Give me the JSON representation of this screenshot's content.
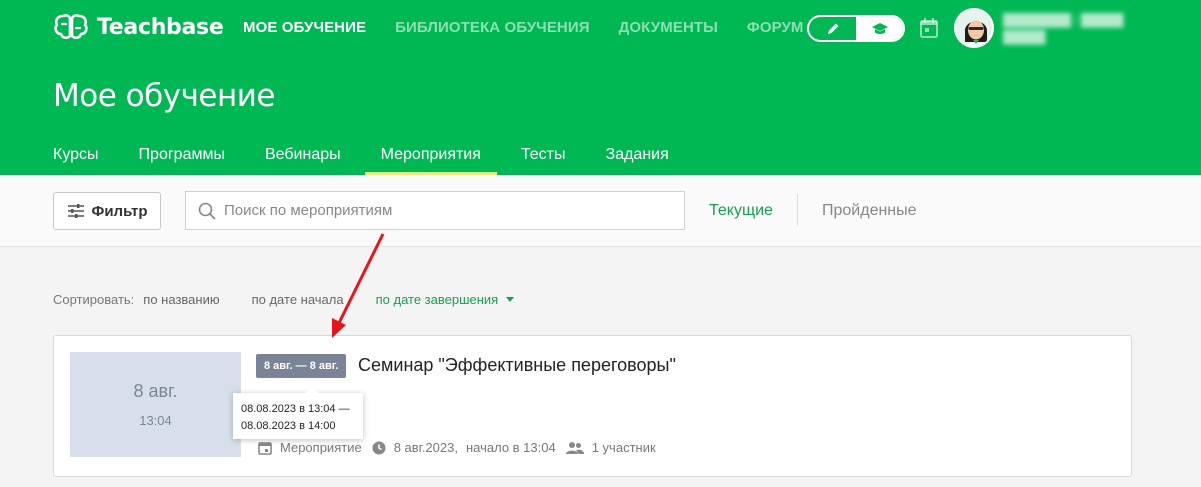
{
  "brand": {
    "name": "Teachbase"
  },
  "nav": {
    "items": [
      {
        "label": "МОЕ ОБУЧЕНИЕ",
        "active": true
      },
      {
        "label": "БИБЛИОТЕКА ОБУЧЕНИЯ",
        "active": false
      },
      {
        "label": "ДОКУМЕНТЫ",
        "active": false
      },
      {
        "label": "ФОРУМ",
        "active": false
      }
    ]
  },
  "header": {
    "mode_icons": [
      "pencil-icon",
      "graduation-cap-icon"
    ],
    "calendar_icon": "calendar-icon"
  },
  "page": {
    "title": "Мое обучение"
  },
  "tabs": [
    {
      "label": "Курсы",
      "active": false
    },
    {
      "label": "Программы",
      "active": false
    },
    {
      "label": "Вебинары",
      "active": false
    },
    {
      "label": "Мероприятия",
      "active": true
    },
    {
      "label": "Тесты",
      "active": false
    },
    {
      "label": "Задания",
      "active": false
    }
  ],
  "toolbar": {
    "filter_label": "Фильтр",
    "search_placeholder": "Поиск по мероприятиям",
    "segment_current": "Текущие",
    "segment_done": "Пройденные"
  },
  "sort": {
    "label": "Сортировать:",
    "options": [
      {
        "label": "по названию",
        "active": false
      },
      {
        "label": "по дате начала",
        "active": false
      },
      {
        "label": "по дате завершения",
        "active": true
      }
    ]
  },
  "event": {
    "thumb_date": "8 авг.",
    "thumb_time": "13:04",
    "date_badge": "8 авг. — 8 авг.",
    "title": "Семинар \"Эффективные переговоры\"",
    "type": "Мероприятие",
    "date": "8 авг.2023,",
    "start": "начало в 13:04",
    "participants": "1 участник",
    "tooltip_line1": "08.08.2023 в 13:04 —",
    "tooltip_line2": "08.08.2023 в 14:00"
  },
  "colors": {
    "brand_green": "#00b853",
    "active_underline": "#dcf27a",
    "accent_text": "#15a050",
    "annotation_arrow": "#e8141b"
  }
}
